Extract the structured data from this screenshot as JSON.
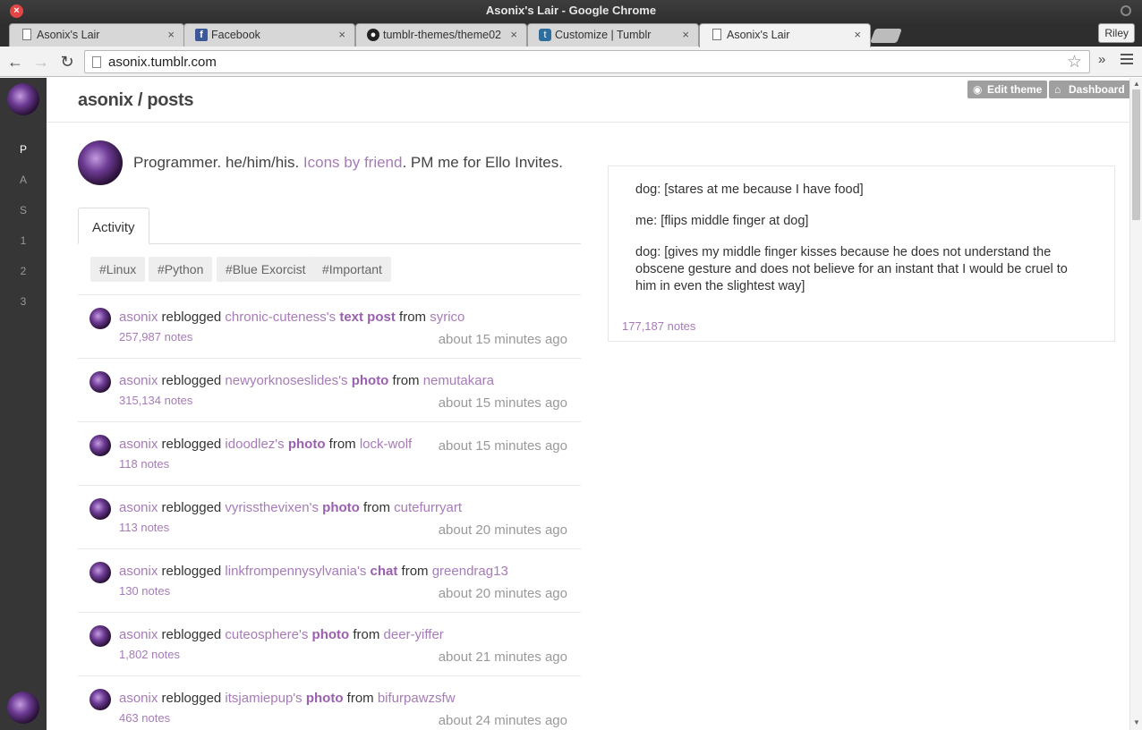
{
  "window": {
    "title": "Asonix's Lair - Google Chrome",
    "profile": "Riley"
  },
  "tabs": [
    {
      "label": "Asonix's Lair",
      "icon": "page-icon"
    },
    {
      "label": "Facebook",
      "icon": "facebook-icon"
    },
    {
      "label": "tumblr-themes/theme02",
      "icon": "github-icon"
    },
    {
      "label": "Customize | Tumblr",
      "icon": "tumblr-icon"
    },
    {
      "label": "Asonix's Lair",
      "icon": "page-icon",
      "active": true
    }
  ],
  "toolbar": {
    "url": "asonix.tumblr.com"
  },
  "sidebar": {
    "items": [
      "P",
      "A",
      "S",
      "1",
      "2",
      "3"
    ],
    "active": "P"
  },
  "header": {
    "title": "asonix / posts",
    "edit_theme": "Edit theme",
    "dashboard": "Dashboard"
  },
  "bio": {
    "before": "Programmer. he/him/his. ",
    "link": "Icons by friend",
    "after": ". PM me for Ello Invites."
  },
  "activity_tab": "Activity",
  "tags": [
    "#Linux",
    "#Python",
    "#Blue Exorcist",
    "#Important"
  ],
  "activity": [
    {
      "user": "asonix",
      "verb": " reblogged ",
      "source": "chronic-cuteness's",
      "type": "text post",
      "from": " from ",
      "origin": "syrico",
      "notes": "257,987 notes",
      "time": "about 15 minutes ago"
    },
    {
      "user": "asonix",
      "verb": " reblogged ",
      "source": "newyorknoseslides's",
      "type": "photo",
      "from": " from ",
      "origin": "nemutakara",
      "notes": "315,134 notes",
      "time": "about 15 minutes ago"
    },
    {
      "user": "asonix",
      "verb": " reblogged ",
      "source": "idoodlez's",
      "type": "photo",
      "from": " from ",
      "origin": "lock-wolf",
      "notes": "118 notes",
      "time": "about 15 minutes ago"
    },
    {
      "user": "asonix",
      "verb": " reblogged ",
      "source": "vyrissthevixen's",
      "type": "photo",
      "from": " from ",
      "origin": "cutefurryart",
      "notes": "113 notes",
      "time": "about 20 minutes ago"
    },
    {
      "user": "asonix",
      "verb": " reblogged ",
      "source": "linkfrompennysylvania's",
      "type": "chat",
      "from": " from ",
      "origin": "greendrag13",
      "notes": "130 notes",
      "time": "about 20 minutes ago"
    },
    {
      "user": "asonix",
      "verb": " reblogged ",
      "source": "cuteosphere's",
      "type": "photo",
      "from": " from ",
      "origin": "deer-yiffer",
      "notes": "1,802 notes",
      "time": "about 21 minutes ago"
    },
    {
      "user": "asonix",
      "verb": " reblogged ",
      "source": "itsjamiepup's",
      "type": "photo",
      "from": " from ",
      "origin": "bifurpawzsfw",
      "notes": "463 notes",
      "time": "about 24 minutes ago"
    }
  ],
  "post": {
    "lines": [
      "dog: [stares at me because I have food]",
      "me: [flips middle finger at dog]",
      "dog: [gives my middle finger kisses because he does not understand the obscene gesture and does not believe for an instant that I would be cruel to him in even the slightest way]"
    ],
    "notes": "177,187 notes"
  }
}
